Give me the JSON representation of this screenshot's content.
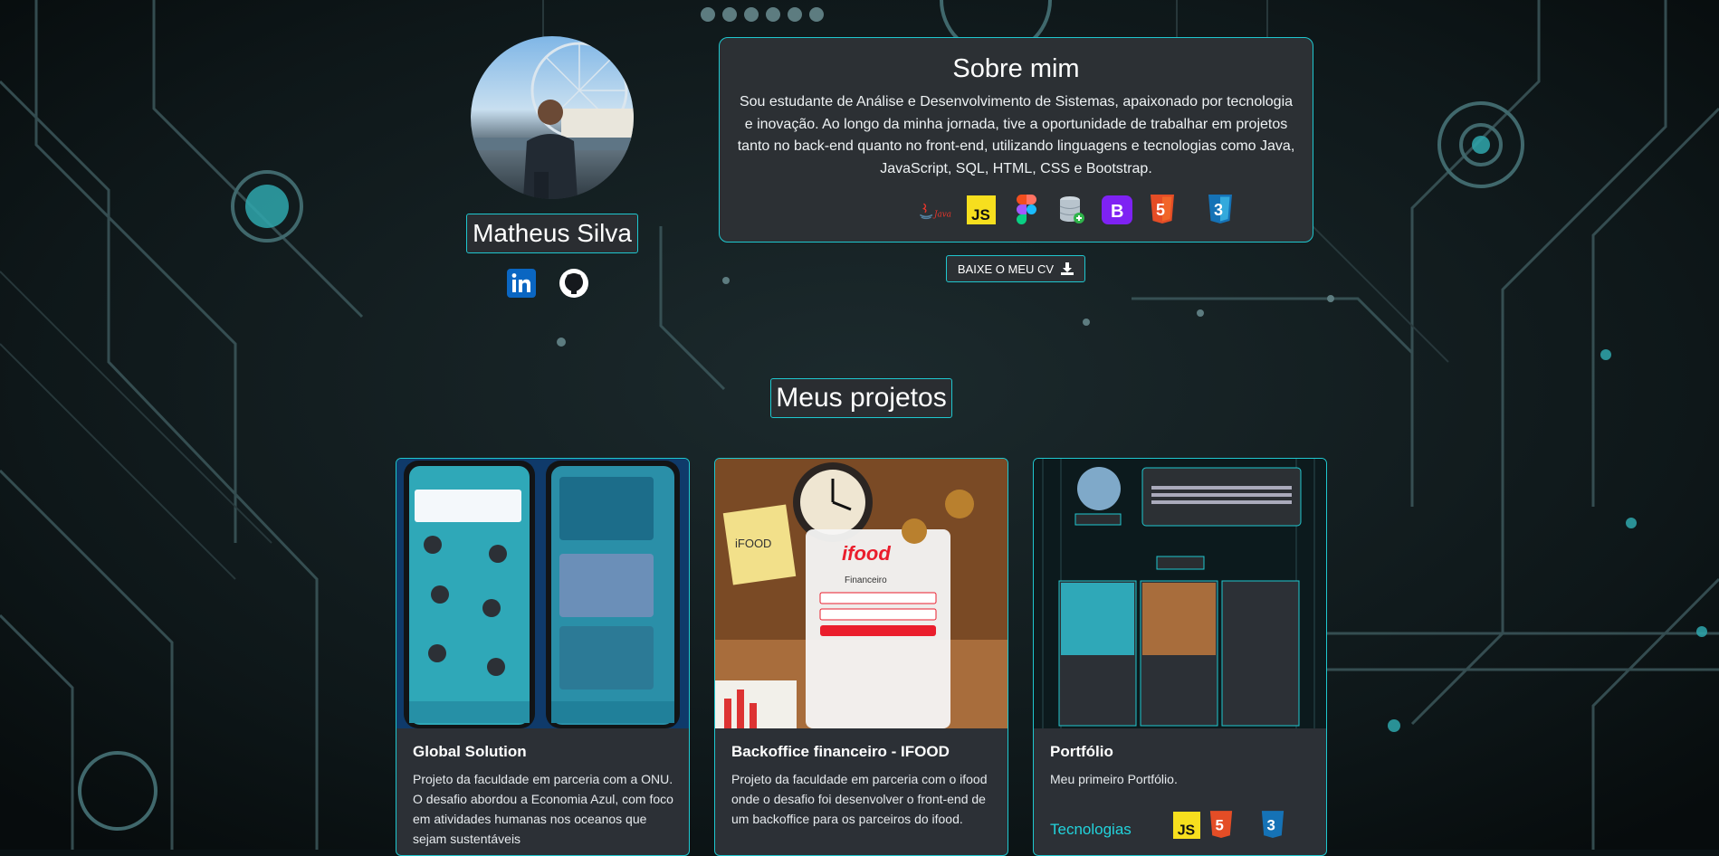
{
  "profile": {
    "name": "Matheus Silva",
    "social": [
      {
        "icon": "linkedin-icon",
        "label": "in"
      },
      {
        "icon": "github-icon",
        "label": ""
      }
    ]
  },
  "about": {
    "title": "Sobre mim",
    "text": "Sou estudante de Análise e Desenvolvimento de Sistemas, apaixonado por tecnologia e inovação. Ao longo da minha jornada, tive a oportunidade de trabalhar em projetos tanto no back-end quanto no front-end, utilizando linguagens e tecnologias como Java, JavaScript, SQL, HTML, CSS e Bootstrap.",
    "techs": [
      "java-icon",
      "javascript-icon",
      "figma-icon",
      "sql-database-icon",
      "bootstrap-icon",
      "html5-icon",
      "css3-icon"
    ],
    "java_label": "Java",
    "js_label": "JS",
    "bootstrap_label": "B",
    "html_label": "5",
    "css_label": "3"
  },
  "cv_button": {
    "label": "BAIXE O MEU CV"
  },
  "projects": {
    "title": "Meus projetos",
    "items": [
      {
        "title": "Global Solution",
        "description": "Projeto da faculdade em parceria com a ONU. O desafio abordou a Economia Azul, com foco em atividades humanas nos oceanos que sejam sustentáveis"
      },
      {
        "title": "Backoffice financeiro - IFOOD",
        "description": "Projeto da faculdade em parceria com o ifood onde o desafio foi desenvolver o front-end de um backoffice para os parceiros do ifood.",
        "thumb_brand": "ifood",
        "thumb_sub": "Financeiro",
        "thumb_note": "iFOOD"
      },
      {
        "title": "Portfólio",
        "description": "Meu primeiro Portfólio.",
        "tech_label": "Tecnologias"
      }
    ]
  },
  "colors": {
    "accent": "#1fc7cf",
    "panel": "#2c3034",
    "background": "#0b1416"
  }
}
